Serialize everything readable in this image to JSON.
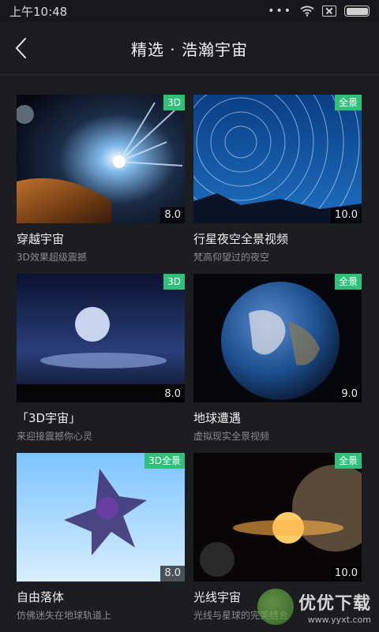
{
  "status": {
    "time": "上午10:48",
    "dots": "•••"
  },
  "header": {
    "title": "精选 · 浩瀚宇宙"
  },
  "cards": [
    {
      "title": "穿越宇宙",
      "subtitle": "3D效果超级震撼",
      "tag": "3D",
      "score": "8.0"
    },
    {
      "title": "行星夜空全景视频",
      "subtitle": "梵高仰望过的夜空",
      "tag": "全景",
      "score": "10.0"
    },
    {
      "title": "「3D宇宙」",
      "subtitle": "来迎接震撼你心灵",
      "tag": "3D",
      "score": "8.0"
    },
    {
      "title": "地球遭遇",
      "subtitle": "虚拟现实全景视频",
      "tag": "全景",
      "score": "9.0"
    },
    {
      "title": "自由落体",
      "subtitle": "仿佛迷失在地球轨道上",
      "tag": "3D全景",
      "score": "8.0"
    },
    {
      "title": "光线宇宙",
      "subtitle": "光线与星球的完美结合",
      "tag": "全景",
      "score": "10.0"
    }
  ],
  "watermark": {
    "name": "优优下载",
    "url": "www.yyxt.com"
  },
  "colors": {
    "tag": "#2fc17a",
    "background": "#1c1d21"
  }
}
